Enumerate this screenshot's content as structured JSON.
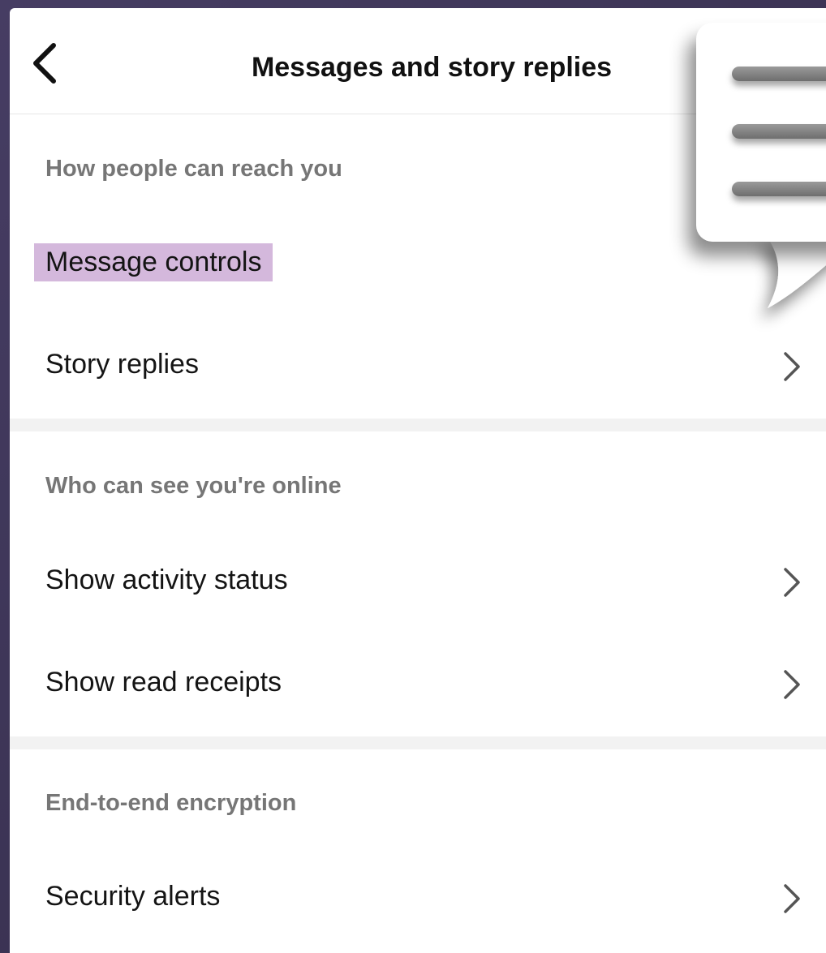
{
  "header": {
    "title": "Messages and story replies",
    "back_icon": "chevron-left-icon"
  },
  "sections": [
    {
      "label": "How people can reach you",
      "items": [
        {
          "label": "Message controls",
          "highlighted": true
        },
        {
          "label": "Story replies"
        }
      ]
    },
    {
      "label": "Who can see you're online",
      "items": [
        {
          "label": "Show activity status"
        },
        {
          "label": "Show read receipts"
        }
      ]
    },
    {
      "label": "End-to-end encryption",
      "items": [
        {
          "label": "Security alerts"
        }
      ]
    }
  ],
  "icons": {
    "row_chevron": "chevron-right-icon",
    "overlay": "chat-bubble-icon"
  },
  "colors": {
    "highlight": "#d4b8dc",
    "section_label": "#767676",
    "background_frame": "#3c3456"
  }
}
